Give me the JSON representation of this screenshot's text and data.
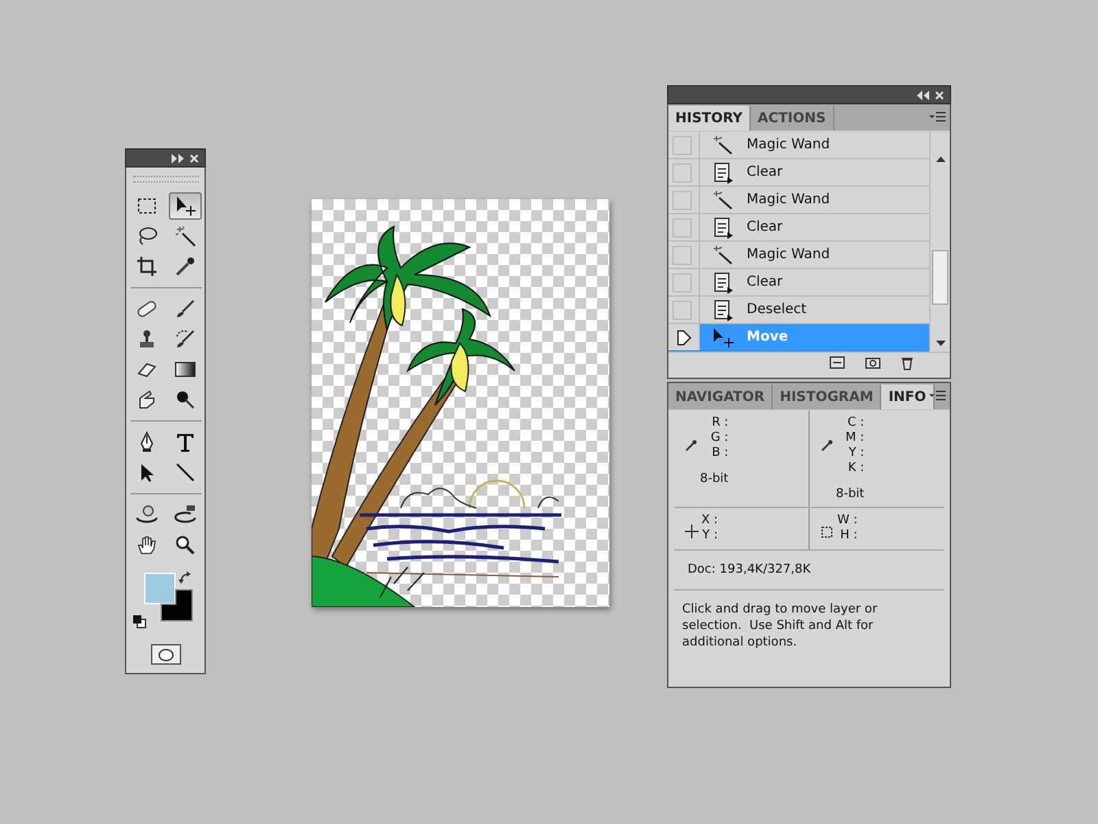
{
  "toolbox": {
    "tool_groups": [
      {
        "tools": [
          {
            "kind": "marquee",
            "selected": false
          },
          {
            "kind": "move",
            "selected": true
          },
          {
            "kind": "lasso",
            "selected": false
          },
          {
            "kind": "wand",
            "selected": false
          },
          {
            "kind": "crop",
            "selected": false
          },
          {
            "kind": "eyedropper",
            "selected": false
          }
        ]
      },
      {
        "tools": [
          {
            "kind": "bandage",
            "selected": false
          },
          {
            "kind": "brush",
            "selected": false
          },
          {
            "kind": "stamp",
            "selected": false
          },
          {
            "kind": "history-brush",
            "selected": false
          },
          {
            "kind": "eraser",
            "selected": false
          },
          {
            "kind": "gradient",
            "selected": false
          },
          {
            "kind": "smudge",
            "selected": false
          },
          {
            "kind": "burn",
            "selected": false
          }
        ]
      },
      {
        "tools": [
          {
            "kind": "pen",
            "selected": false
          },
          {
            "kind": "type",
            "selected": false
          },
          {
            "kind": "arrow",
            "selected": false
          },
          {
            "kind": "line",
            "selected": false
          }
        ]
      },
      {
        "tools": [
          {
            "kind": "rotate3d",
            "selected": false
          },
          {
            "kind": "orbit3d",
            "selected": false
          },
          {
            "kind": "hand",
            "selected": false
          },
          {
            "kind": "zoom",
            "selected": false
          }
        ]
      }
    ],
    "swatches": [
      {
        "kind": "foreground",
        "color": "#9ecae2"
      },
      {
        "kind": "background",
        "color": "#000000"
      }
    ]
  },
  "history_panel": {
    "tabs": [
      {
        "label": "HISTORY",
        "selected": true
      },
      {
        "label": "ACTIONS",
        "selected": false
      }
    ],
    "items": [
      {
        "label": "Magic Wand",
        "kind": "wand",
        "selected": false,
        "snapshot": false
      },
      {
        "label": "Clear",
        "kind": "document",
        "selected": false,
        "snapshot": false
      },
      {
        "label": "Magic Wand",
        "kind": "wand",
        "selected": false,
        "snapshot": false
      },
      {
        "label": "Clear",
        "kind": "document",
        "selected": false,
        "snapshot": false
      },
      {
        "label": "Magic Wand",
        "kind": "wand",
        "selected": false,
        "snapshot": false
      },
      {
        "label": "Clear",
        "kind": "document",
        "selected": false,
        "snapshot": false
      },
      {
        "label": "Deselect",
        "kind": "document",
        "selected": false,
        "snapshot": false
      },
      {
        "label": "Move",
        "kind": "move",
        "selected": true
      }
    ]
  },
  "info_panel": {
    "tabs": [
      {
        "label": "NAVIGATOR",
        "selected": false
      },
      {
        "label": "HISTOGRAM",
        "selected": false
      },
      {
        "label": "INFO",
        "selected": true
      }
    ],
    "color_readouts": [
      {
        "labels": [
          "R :",
          "G :",
          "B :"
        ],
        "depth": "8-bit"
      },
      {
        "labels": [
          "C :",
          "M :",
          "Y :",
          "K :"
        ],
        "depth": "8-bit"
      }
    ],
    "position_readouts": [
      {
        "kind": "position",
        "labels": [
          "X :",
          "Y :"
        ]
      },
      {
        "kind": "size",
        "labels": [
          "W :",
          "H :"
        ]
      }
    ],
    "doc_size": "Doc: 193,4K/327,8K",
    "hint": "Click and drag to move layer or selection.  Use Shift and Alt for additional options."
  }
}
